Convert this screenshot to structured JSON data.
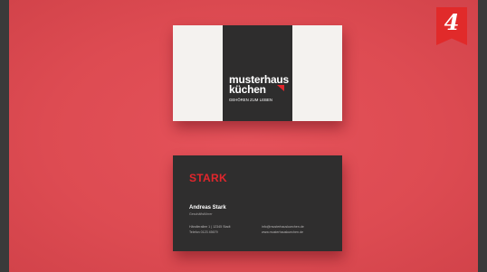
{
  "badge": {
    "number": "4"
  },
  "card_front": {
    "logo_line1": "musterhaus",
    "logo_line2": "küchen",
    "tagline": "GEHÖREN ZUM LEBEN"
  },
  "card_back": {
    "brand": "STARK",
    "name": "Andreas Stark",
    "role": "Geschäftsführer",
    "address": "Händlerallee 1 | 12345 Stadt",
    "phone": "Telefon 0123 45679",
    "email": "info@musterhauskuechen.de",
    "website": "www.musterhauskuechen.de"
  },
  "colors": {
    "background": "#dd4b52",
    "accent": "#e2262c",
    "card_dark": "#2f2e2e",
    "card_light": "#f4f2ef"
  }
}
